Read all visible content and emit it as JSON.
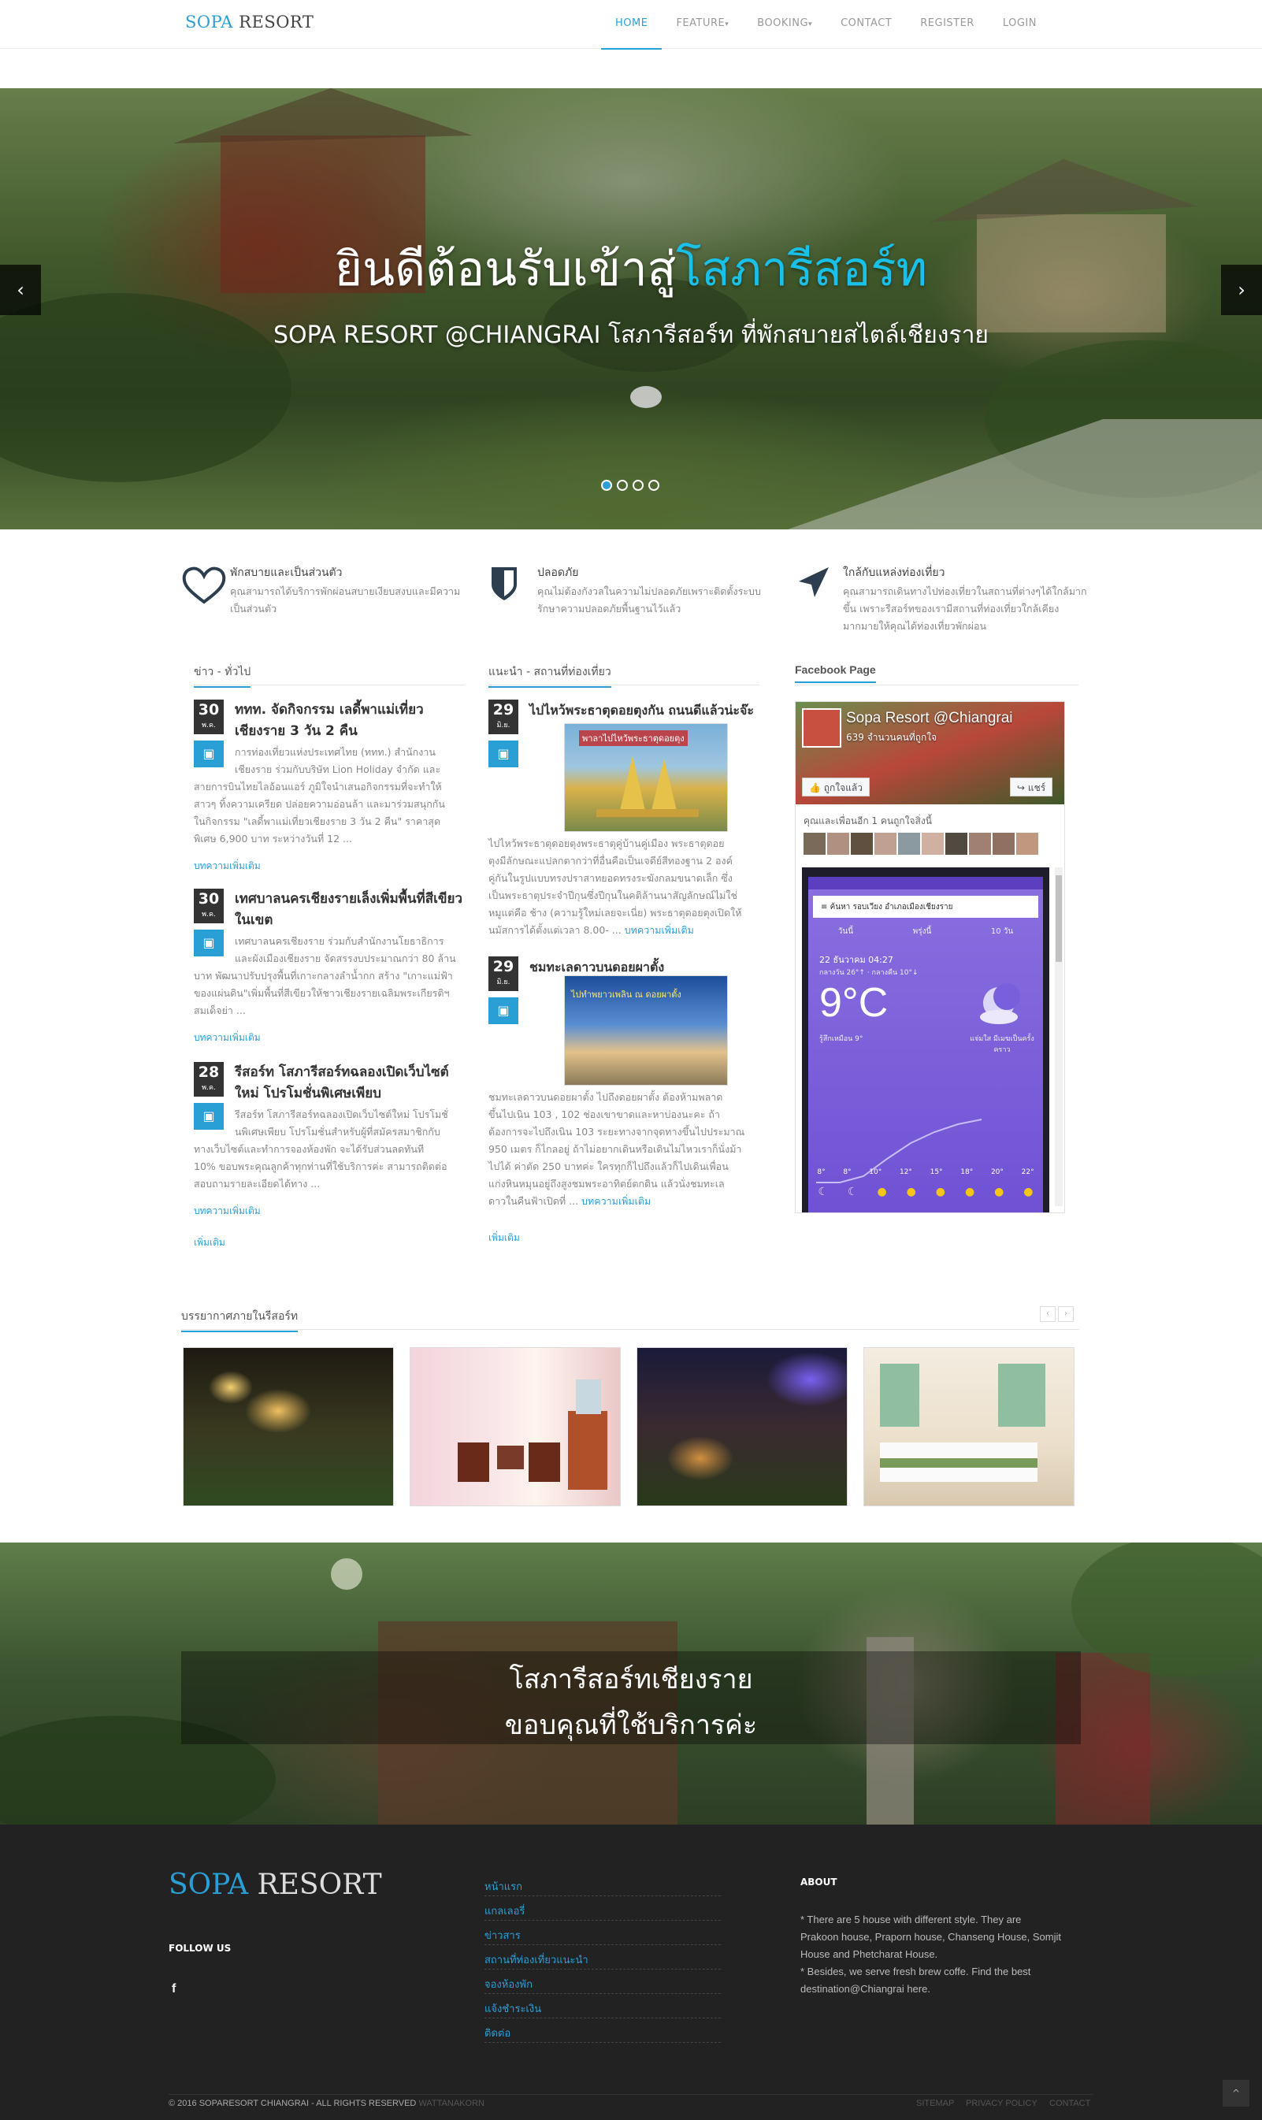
{
  "nav": {
    "brand_a": "SOPA",
    "brand_b": "RESORT",
    "items": [
      "HOME",
      "FEATURE",
      "BOOKING",
      "CONTACT",
      "REGISTER",
      "LOGIN"
    ]
  },
  "hero": {
    "title_a": "ยินดีต้อนรับเข้าสู่",
    "title_b": "โสภารีสอร์ท",
    "subtitle": "SOPA RESORT @CHIANGRAI โสภารีสอร์ท ที่พักสบายสไตล์เชียงราย",
    "prev": "‹",
    "next": "›"
  },
  "features": [
    {
      "title": "พักสบายและเป็นส่วนตัว",
      "desc": "คุณสามารถได้บริการพักผ่อนสบายเงียบสงบและมีความเป็นส่วนตัว",
      "icon": "heart-icon"
    },
    {
      "title": "ปลอดภัย",
      "desc": "คุณไม่ต้องกังวลในความไม่ปลอดภัยเพราะติดตั้งระบบรักษาความปลอดภัยพื้นฐานไว้แล้ว",
      "icon": "shield-icon"
    },
    {
      "title": "ใกล้กับแหล่งท่องเที่ยว",
      "desc": "คุณสามารถเดินทางไปท่องเที่ยวในสถานที่ต่างๆได้ใกล้มากขึ้น เพราะรีสอร์ทของเรามีสถานที่ท่องเที่ยวใกล้เคียงมากมายให้คุณได้ท่องเที่ยวพักผ่อน",
      "icon": "location-arrow-icon"
    }
  ],
  "news": {
    "heading": "ข่าว - ทั่วไป",
    "posts": [
      {
        "day": "30",
        "mon": "พ.ค.",
        "title_1": "ททท. จัดกิจกรรม เลดี้พาแม่เที่ยว",
        "title_2": "เชียงราย 3 วัน 2 คืน",
        "lines": [
          "การท่องเที่ยวแห่งประเทศไทย (ททท.) สำนักงาน",
          "เชียงราย ร่วมกับบริษัท Lion Holiday จำกัด และ",
          "สายการบินไทยไลอ้อนแอร์ ภูมิใจนำเสนอกิจกรรมที่จะทำให้",
          "สาวๆ ทิ้งความเครียด ปล่อยความอ่อนล้า และมาร่วมสนุกกัน",
          "ในกิจกรรม \"เลดี้พาแม่เที่ยวเชียงราย 3 วัน 2 คืน\" ราคาสุด",
          "พิเศษ 6,900 บาท ระหว่างวันที่ 12 ..."
        ],
        "more": "บทความเพิ่มเติม"
      },
      {
        "day": "30",
        "mon": "พ.ค.",
        "title_1": "เทศบาลนครเชียงรายเล็งเพิ่มพื้นที่สีเขียว",
        "title_2": "ในเขต",
        "lines": [
          "เทศบาลนครเชียงราย ร่วมกับสำนักงานโยธาธิการ",
          "และผังเมืองเชียงราย จัดสรรงบประมาณกว่า 80 ล้าน",
          "บาท พัฒนาปรับปรุงพื้นที่เกาะกลางลำน้ำกก สร้าง \"เกาะแม่ฟ้า",
          "ของแผ่นดิน\"เพิ่มพื้นที่สีเขียวให้ชาวเชียงรายเฉลิมพระเกียรติฯ",
          "สมเด็จย่า ..."
        ],
        "more": "บทความเพิ่มเติม"
      },
      {
        "day": "28",
        "mon": "พ.ค.",
        "title_1": "รีสอร์ท โสภารีสอร์ทฉลองเปิดเว็บไซต์",
        "title_2": "ใหม่ โปรโมชั่นพิเศษเพียบ",
        "lines": [
          "รีสอร์ท โสภารีสอร์ทฉลองเปิดเว็บไซต์ใหม่ โปรโมชั่",
          "นพิเศษเพียบ โปรโมชั่นสำหรับผู้ที่สมัครสมาชิกกับ",
          "ทางเว็บไซต์และทำการจองห้องพัก จะได้รับส่วนลดทันที",
          "10% ขอบพระคุณลูกค้าทุกท่านที่ใช้บริการค่ะ สามารถติดต่อ",
          "สอบถามรายละเอียดได้ทาง ..."
        ],
        "more": "บทความเพิ่มเติม"
      }
    ],
    "see_more": "เพิ่มเติม"
  },
  "travel": {
    "heading": "แนะนำ - สถานที่ท่องเที่ยว",
    "posts": [
      {
        "day": "29",
        "mon": "มิ.ย.",
        "title": "ไปไหว้พระธาตุดอยตุงกัน ถนนดีแล้วน่ะจ๊ะ",
        "img_caption": "พาลาไปไหว้พระธาตุดอยตุง",
        "lines": [
          "ไปไหว้พระธาตุดอยตุงพระธาตุคู่บ้านคู่เมือง    พระธาตุดอย",
          "ตุงมีลักษณะแปลกตากว่าที่อื่นคือเป็นเจดีย์สีทองฐาน 2 องค์",
          "คู่กันในรูปแบบทรงปราสาทยอดทรงระฆังกลมขนาดเล็ก ซึ่ง",
          "เป็นพระธาตุประจำปีกุนซึ่งปีกุนในคติล้านนาสัญลักษณ์ไม่ใช่",
          "หมูแต่คือ ช้าง (ความรู้ใหม่เลยจะเนี่ย) พระธาตุดอยตุงเปิดให้",
          "นมัสการได้ตั้งแต่เวลา 8.00- ..."
        ],
        "more": "บทความเพิ่มเติม"
      },
      {
        "day": "29",
        "mon": "มิ.ย.",
        "title": "ชมทะเลดาวบนดอยผาตั้ง",
        "img_caption": "ไปทำพยาวเพลิน ณ ดอยผาตั้ง",
        "lines": [
          "ชมทะเลดาวบนดอยผาตั้ง      ไปถึงดอยผาตั้ง ต้องห้ามพลาด",
          "ขึ้นไปเนิน 103 , 102 ช่องเขาขาดและหาบ่องนะคะ ถ้า",
          "ต้องการจะไปถึงเนิน 103 ระยะทางจากจุดทางขึ้นไปประมาณ",
          "950 เมตร ก็ไกลอยู่ ถ้าไม่อยากเดินหรือเดินไม่ไหวเราก็นั่งม้า",
          "ไปได้ ค่าตัด 250 บาทค่ะ ใครทุกก็ไปถึงแล้วก็ไปเดินเพื่อน",
          "แก่งหินหมุนอยู่ถึงสูงชมพระอาทิตย์ตกดิน แล้วนั่งชมทะเล",
          "ดาวในคืนฟ้าเปิดที่ ..."
        ],
        "more": "บทความเพิ่มเติม"
      }
    ],
    "see_more": "เพิ่มเติม"
  },
  "facebook": {
    "heading": "Facebook Page",
    "page_name": "Sopa Resort @Chiangrai",
    "likes": "639 จำนวนคนที่ถูกใจ",
    "like_btn": "ถูกใจแล้ว",
    "share_btn": "แชร์",
    "friends": "คุณและเพื่อนอีก 1 คนถูกใจสิ่งนี้",
    "phone_search": "ค้นหา รอบเวียง อำเภอเมืองเชียงราย",
    "phone_tabs": [
      "วันนี้",
      "พรุ่งนี้",
      "10 วัน"
    ],
    "date": "22 ธันวาคม 04:27",
    "range": "กลางวัน 26°↑ · กลางคืน 10°↓",
    "temp": "9°C",
    "feels": "รู้สึกเหมือน 9°",
    "condition": "แจ่มใส มีเมฆเป็นครั้งคราว",
    "temps_row": [
      "8°",
      "8°",
      "10°",
      "12°",
      "15°",
      "18°",
      "20°",
      "22°"
    ]
  },
  "gallery": {
    "heading": "บรรยากาศภายในรีสอร์ท",
    "prev": "‹",
    "next": "›"
  },
  "banner": {
    "line1": "โสภารีสอร์ทเชียงราย",
    "line2": "ขอบคุณที่ใช้บริการค่ะ"
  },
  "footer": {
    "brand_a": "SOPA",
    "brand_b": "RESORT",
    "follow": "FOLLOW US",
    "fb_icon": "f",
    "links": [
      "หน้าแรก",
      "แกลเลอรี่",
      "ข่าวสาร",
      "สถานที่ท่องเที่ยวแนะนำ",
      "จองห้องพัก",
      "แจ้งชำระเงิน",
      "ติดต่อ"
    ],
    "about_title": "ABOUT",
    "about_lines": [
      "* There are 5 house with different style. They are",
      "Prakoon house, Praporn house, Chanseng House, Somjit",
      "House and Phetcharat House.",
      "* Besides, we serve fresh brew coffe. Find the best",
      "destination@Chiangrai here."
    ],
    "copyright": "© 2016 SOPARESORT CHIANGRAI - ALL RIGHTS RESERVED",
    "author": "WATTANAKORN",
    "bottom_links": [
      "SITEMAP",
      "PRIVACY POLICY",
      "CONTACT"
    ],
    "to_top": "^"
  }
}
